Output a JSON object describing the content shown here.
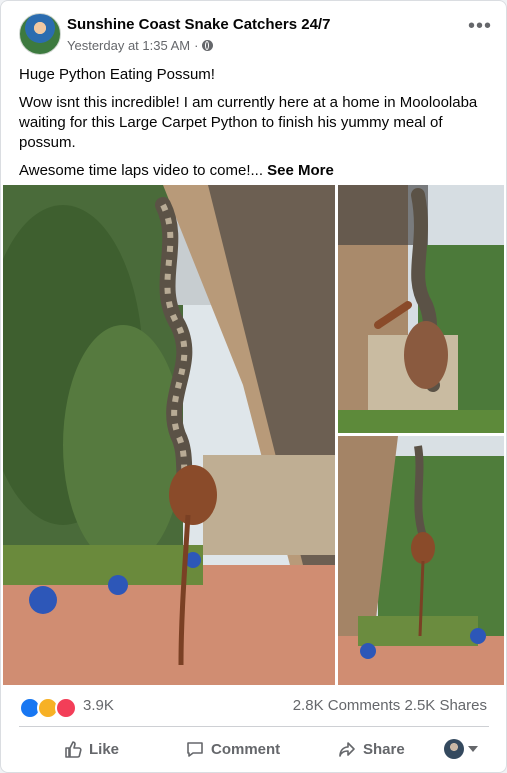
{
  "post": {
    "page_name": "Sunshine Coast Snake Catchers 24/7",
    "timestamp": "Yesterday at 1:35 AM",
    "separator": "·",
    "audience_icon": "globe-icon",
    "more_icon": "more-options-icon",
    "more_glyph": "•••",
    "headline": "Huge Python Eating Possum!",
    "body": "Wow isnt this incredible! I am currently here at a home in Mooloolaba waiting for this Large Carpet Python to finish his yummy meal of possum.",
    "teaser": "Awesome time laps video to come!...",
    "see_more": "See More"
  },
  "stats": {
    "reactions": [
      "like",
      "wow",
      "love"
    ],
    "reaction_count": "3.9K",
    "comments": "2.8K Comments",
    "shares": "2.5K Shares"
  },
  "actions": {
    "like": "Like",
    "comment": "Comment",
    "share": "Share"
  },
  "colors": {
    "brand_blue": "#1877f2",
    "secondary_text": "#65676b",
    "wow_yellow": "#f7b125",
    "love_red": "#f33e58"
  }
}
